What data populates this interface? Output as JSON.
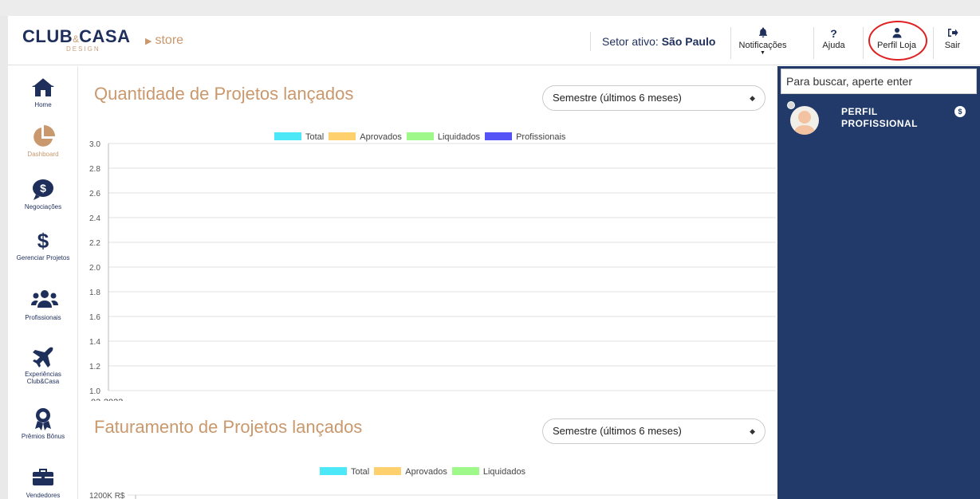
{
  "header": {
    "logo_main_a": "CLUB",
    "logo_amp": "&",
    "logo_main_b": "CASA",
    "logo_sub": "DESIGN",
    "store": "store",
    "setor_label": "Setor ativo:",
    "setor_value": "São Paulo",
    "buttons": {
      "notificacoes": "Notificações",
      "ajuda": "Ajuda",
      "perfil": "Perfil Loja",
      "sair": "Sair"
    }
  },
  "sidebar": {
    "items": [
      {
        "label": "Home",
        "icon": "home-icon"
      },
      {
        "label": "Dashboard",
        "icon": "pie-chart-icon"
      },
      {
        "label": "Negociações",
        "icon": "money-bubble-icon"
      },
      {
        "label": "Gerenciar Projetos",
        "icon": "dollar-icon"
      },
      {
        "label": "Profissionais",
        "icon": "users-icon"
      },
      {
        "label": "Experiências Club&Casa",
        "icon": "plane-icon"
      },
      {
        "label": "Prêmios Bônus",
        "icon": "award-icon"
      },
      {
        "label": "Vendedores",
        "icon": "briefcase-icon"
      }
    ]
  },
  "main": {
    "section1": {
      "title": "Quantidade de Projetos lançados",
      "select_value": "Semestre (últimos 6 meses)"
    },
    "section2": {
      "title": "Faturamento de Projetos lançados",
      "select_value": "Semestre (últimos 6 meses)"
    }
  },
  "chart_data": [
    {
      "type": "line",
      "title": "",
      "legend": [
        "Total",
        "Aprovados",
        "Liquidados",
        "Profissionais"
      ],
      "legend_colors": [
        "#4de8f7",
        "#ffd06e",
        "#9ff88a",
        "#5553f5"
      ],
      "categories": [
        "03-2023"
      ],
      "series": [],
      "yticks": [
        "3.0",
        "2.8",
        "2.6",
        "2.4",
        "2.2",
        "2.0",
        "1.8",
        "1.6",
        "1.4",
        "1.2",
        "1.0"
      ],
      "ylim": [
        1.0,
        3.0
      ],
      "legend_position": "top-center",
      "grid": true
    },
    {
      "type": "line",
      "title": "",
      "legend": [
        "Total",
        "Aprovados",
        "Liquidados"
      ],
      "legend_colors": [
        "#4de8f7",
        "#ffd06e",
        "#9ff88a"
      ],
      "yticks": [
        "1200K R$"
      ],
      "legend_position": "top-center",
      "grid": true
    }
  ],
  "right_panel": {
    "search_placeholder": "Para buscar, aperte enter",
    "profile_name": "PERFIL PROFISSIONAL",
    "money_icon": "$"
  },
  "colors": {
    "navy": "#1f2f5c",
    "gold": "#c9986d",
    "panel": "#223a6a"
  }
}
